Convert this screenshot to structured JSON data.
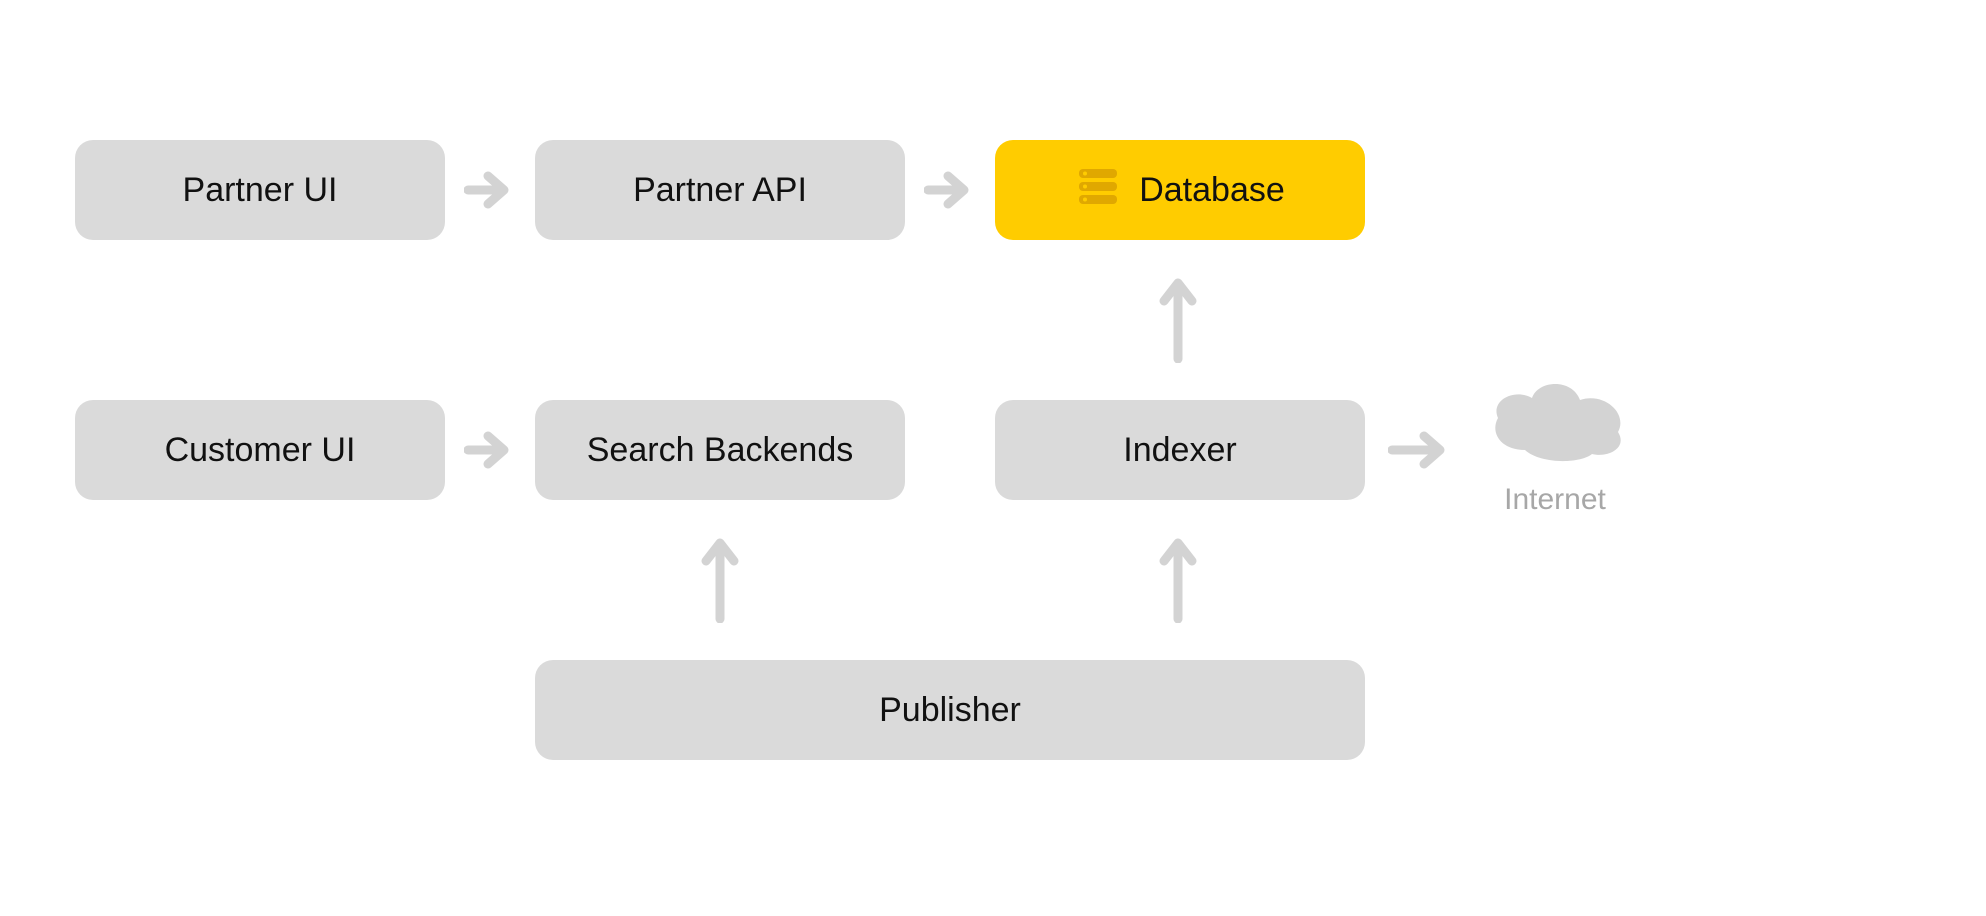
{
  "nodes": {
    "partner_ui": {
      "label": "Partner UI"
    },
    "partner_api": {
      "label": "Partner API"
    },
    "database": {
      "label": "Database"
    },
    "customer_ui": {
      "label": "Customer UI"
    },
    "search_backends": {
      "label": "Search Backends"
    },
    "indexer": {
      "label": "Indexer"
    },
    "publisher": {
      "label": "Publisher"
    }
  },
  "external": {
    "internet": {
      "label": "Internet"
    }
  },
  "highlight": "database",
  "colors": {
    "node_gray": "#dadada",
    "node_highlight": "#ffcc00",
    "arrow": "#d3d3d3",
    "text": "#111111",
    "muted_text": "#a7a7a7"
  },
  "arrows": [
    {
      "from": "partner_ui",
      "to": "partner_api",
      "dir": "right"
    },
    {
      "from": "partner_api",
      "to": "database",
      "dir": "right"
    },
    {
      "from": "customer_ui",
      "to": "search_backends",
      "dir": "right"
    },
    {
      "from": "indexer",
      "to": "internet",
      "dir": "right"
    },
    {
      "from": "indexer",
      "to": "database",
      "dir": "up"
    },
    {
      "from": "publisher",
      "to": "search_backends",
      "dir": "up"
    },
    {
      "from": "publisher",
      "to": "indexer",
      "dir": "up"
    }
  ]
}
